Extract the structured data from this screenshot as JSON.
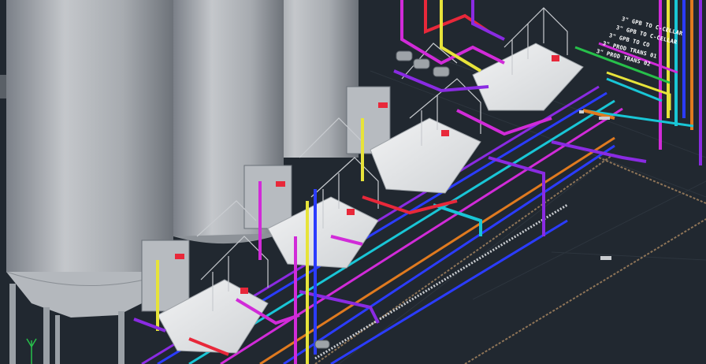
{
  "viewport": {
    "background": "#212830",
    "accent_colors": {
      "silo": "#a9adb2",
      "platform": "#e6e8ea",
      "pipe_magenta": "#d12bd8",
      "pipe_purple": "#8a2be2",
      "pipe_blue": "#2b3cff",
      "pipe_cyan": "#19c6d6",
      "pipe_yellow": "#e7e33a",
      "pipe_orange": "#e07a1f",
      "pipe_green": "#27c04a",
      "pipe_red": "#e8283a",
      "railing": "#c9ccd0"
    }
  },
  "callouts": [
    {
      "text": "3\" GPB TO C-CELLAR"
    },
    {
      "text": "3\" GPB TO C-CELLAR"
    },
    {
      "text": "3\" GPB TO CO"
    },
    {
      "text": "3\" PROD TRANS 01"
    },
    {
      "text": "3\" PROD TRANS 02"
    }
  ]
}
